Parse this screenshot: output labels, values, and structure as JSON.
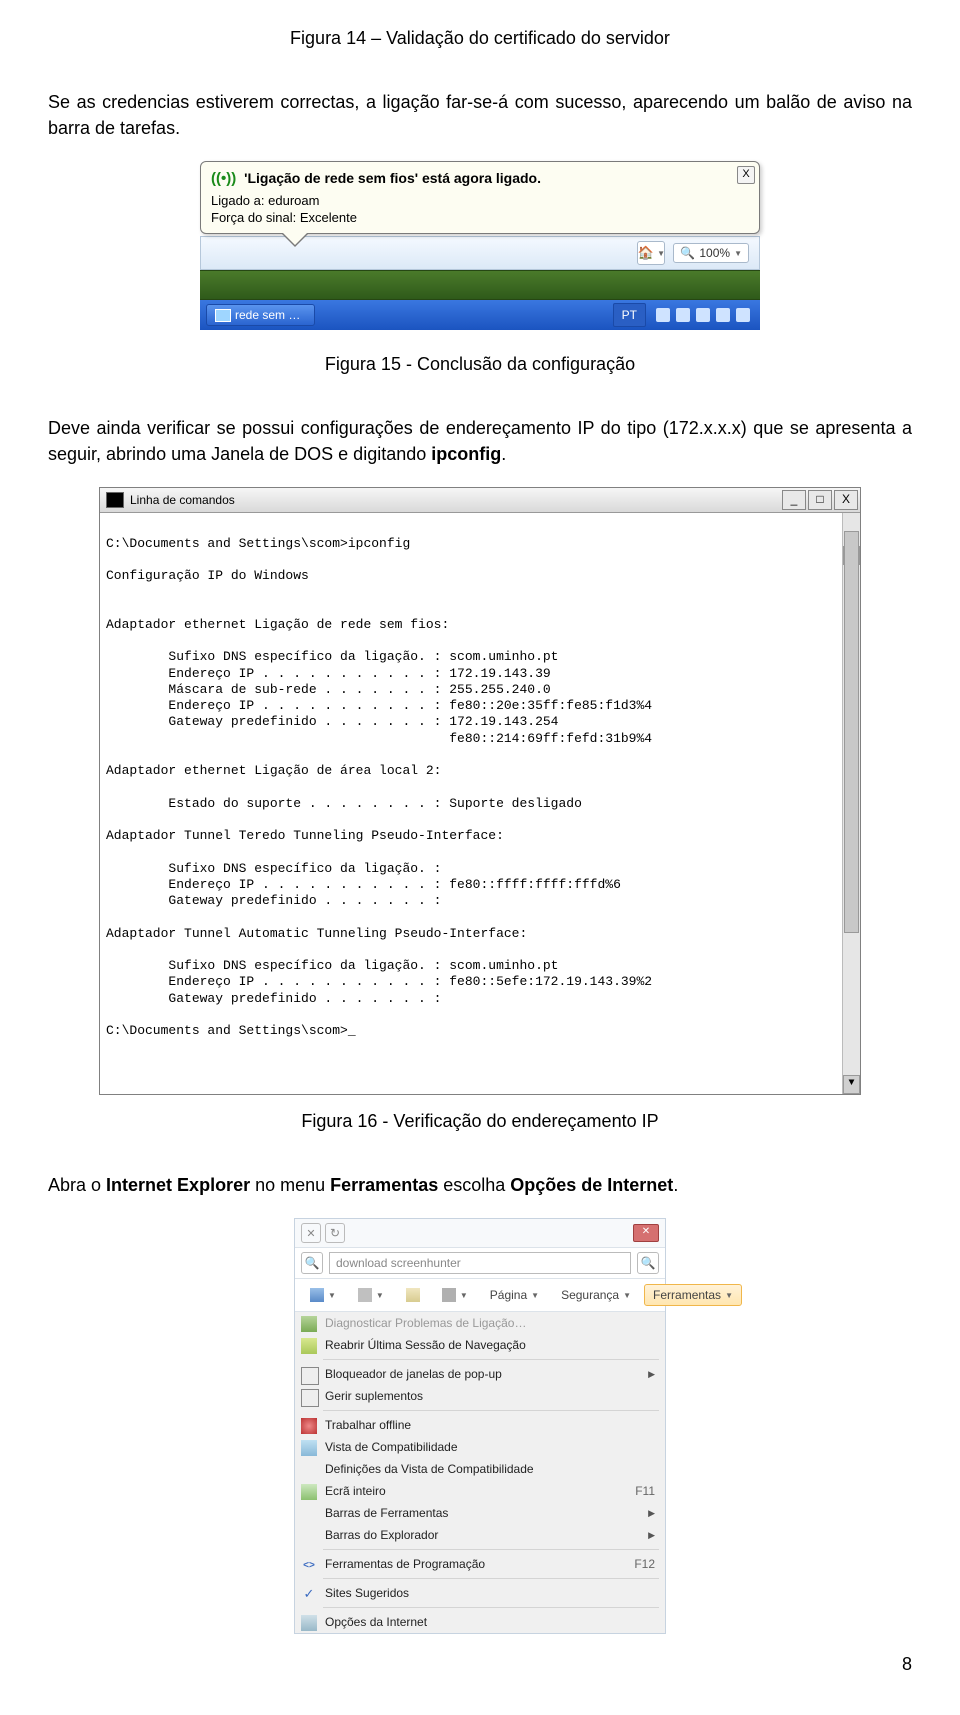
{
  "caption14": "Figura 14 – Validação do certificado do servidor",
  "para1": "Se as credencias estiverem correctas, a ligação far-se-á com sucesso, aparecendo um balão de aviso na barra de tarefas.",
  "fig15": {
    "balloon_title": "'Ligação de rede sem fios' está agora ligado.",
    "close_x": "X",
    "line1_label": "Ligado a:",
    "line1_value": "eduroam",
    "line2_label": "Força do sinal:",
    "line2_value": "Excelente",
    "zoom": "100%",
    "task_label": "rede sem …",
    "lang": "PT"
  },
  "caption15": "Figura 15 - Conclusão da configuração",
  "para2a": "Deve ainda verificar se possui configurações de endereçamento IP do tipo (172.x.x.x) que se apresenta a seguir, abrindo uma Janela de DOS e digitando ",
  "para2b": "ipconfig",
  "para2c": ".",
  "cmd": {
    "title": "Linha de comandos",
    "lines": [
      "",
      "C:\\Documents and Settings\\scom>ipconfig",
      "",
      "Configuração IP do Windows",
      "",
      "",
      "Adaptador ethernet Ligação de rede sem fios:",
      "",
      "        Sufixo DNS específico da ligação. : scom.uminho.pt",
      "        Endereço IP . . . . . . . . . . . : 172.19.143.39",
      "        Máscara de sub-rede . . . . . . . : 255.255.240.0",
      "        Endereço IP . . . . . . . . . . . : fe80::20e:35ff:fe85:f1d3%4",
      "        Gateway predefinido . . . . . . . : 172.19.143.254",
      "                                            fe80::214:69ff:fefd:31b9%4",
      "",
      "Adaptador ethernet Ligação de área local 2:",
      "",
      "        Estado do suporte . . . . . . . . : Suporte desligado",
      "",
      "Adaptador Tunnel Teredo Tunneling Pseudo-Interface:",
      "",
      "        Sufixo DNS específico da ligação. :",
      "        Endereço IP . . . . . . . . . . . : fe80::ffff:ffff:fffd%6",
      "        Gateway predefinido . . . . . . . :",
      "",
      "Adaptador Tunnel Automatic Tunneling Pseudo-Interface:",
      "",
      "        Sufixo DNS específico da ligação. : scom.uminho.pt",
      "        Endereço IP . . . . . . . . . . . : fe80::5efe:172.19.143.39%2",
      "        Gateway predefinido . . . . . . . :",
      "",
      "C:\\Documents and Settings\\scom>_"
    ]
  },
  "caption16": "Figura 16 - Verificação do endereçamento IP",
  "para3a": "Abra o ",
  "para3b": "Internet Explorer",
  "para3c": " no menu ",
  "para3d": "Ferramentas",
  "para3e": " escolha ",
  "para3f": "Opções de Internet",
  "para3g": ".",
  "ie": {
    "search_placeholder": "download screenhunter",
    "tb_pagina": "Página",
    "tb_seguranca": "Segurança",
    "tb_ferramentas": "Ferramentas",
    "menu": {
      "diag": "Diagnosticar Problemas de Ligação…",
      "reopen": "Reabrir Última Sessão de Navegação",
      "popup": "Bloqueador de janelas de pop-up",
      "addons": "Gerir suplementos",
      "offline": "Trabalhar offline",
      "compat": "Vista de Compatibilidade",
      "compat_def": "Definições da Vista de Compatibilidade",
      "fullscreen": "Ecrã inteiro",
      "fullscreen_kbd": "F11",
      "toolbars": "Barras de Ferramentas",
      "explorer_bars": "Barras do Explorador",
      "devtools": "Ferramentas de Programação",
      "devtools_kbd": "F12",
      "suggested": "Sites Sugeridos",
      "options": "Opções da Internet"
    }
  },
  "page_number": "8"
}
